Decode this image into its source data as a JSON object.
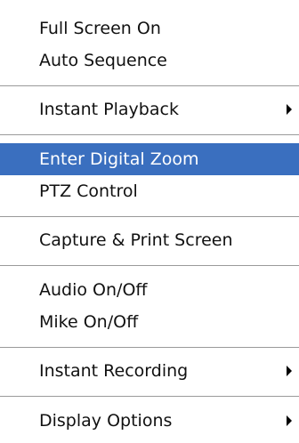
{
  "menu": {
    "items": [
      {
        "label": "Full Screen On"
      },
      {
        "label": "Auto Sequence"
      },
      {
        "label": "Instant Playback",
        "submenu": "right-arrow-icon"
      },
      {
        "label": "Enter Digital Zoom",
        "state": "highlighted"
      },
      {
        "label": "PTZ Control"
      },
      {
        "label": "Capture & Print Screen"
      },
      {
        "label": "Audio On/Off"
      },
      {
        "label": "Mike On/Off"
      },
      {
        "label": "Instant Recording",
        "submenu": "right-arrow-icon"
      },
      {
        "label": "Display Options",
        "submenu": "right-arrow-icon"
      }
    ]
  },
  "colors": {
    "highlight_background": "#3a6fbf",
    "highlight_text": "#ffffff",
    "separator": "#9a9a9a",
    "text": "#111111"
  }
}
